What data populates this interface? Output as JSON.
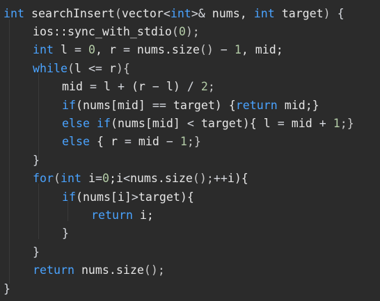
{
  "code": {
    "lines": [
      {
        "indent": 0,
        "tokens": [
          {
            "t": "int",
            "c": "kw"
          },
          {
            "t": " ",
            "c": "id"
          },
          {
            "t": "searchInsert",
            "c": "fn"
          },
          {
            "t": "(",
            "c": "punc"
          },
          {
            "t": "vector",
            "c": "id"
          },
          {
            "t": "<",
            "c": "op"
          },
          {
            "t": "int",
            "c": "kw"
          },
          {
            "t": ">&",
            "c": "op"
          },
          {
            "t": " nums, ",
            "c": "id"
          },
          {
            "t": "int",
            "c": "kw"
          },
          {
            "t": " target",
            "c": "id"
          },
          {
            "t": ")",
            "c": "punc"
          },
          {
            "t": " {",
            "c": "brace"
          }
        ]
      },
      {
        "indent": 1,
        "tokens": [
          {
            "t": "ios::sync_with_stdio",
            "c": "fn"
          },
          {
            "t": "(",
            "c": "punc"
          },
          {
            "t": "0",
            "c": "num"
          },
          {
            "t": ");",
            "c": "punc"
          }
        ]
      },
      {
        "indent": 1,
        "tokens": [
          {
            "t": "int",
            "c": "kw"
          },
          {
            "t": " l ",
            "c": "id"
          },
          {
            "t": "=",
            "c": "op"
          },
          {
            "t": " ",
            "c": "id"
          },
          {
            "t": "0",
            "c": "num"
          },
          {
            "t": ", r ",
            "c": "id"
          },
          {
            "t": "=",
            "c": "op"
          },
          {
            "t": " nums.",
            "c": "id"
          },
          {
            "t": "size",
            "c": "fn"
          },
          {
            "t": "()",
            "c": "punc"
          },
          {
            "t": " − ",
            "c": "op"
          },
          {
            "t": "1",
            "c": "num"
          },
          {
            "t": ", mid;",
            "c": "id"
          }
        ]
      },
      {
        "indent": 1,
        "tokens": [
          {
            "t": "while",
            "c": "kw"
          },
          {
            "t": "(",
            "c": "punc"
          },
          {
            "t": "l ",
            "c": "id"
          },
          {
            "t": "<=",
            "c": "op"
          },
          {
            "t": " r",
            "c": "id"
          },
          {
            "t": "){",
            "c": "punc"
          }
        ]
      },
      {
        "indent": 2,
        "tokens": [
          {
            "t": "mid ",
            "c": "id"
          },
          {
            "t": "=",
            "c": "op"
          },
          {
            "t": " l ",
            "c": "id"
          },
          {
            "t": "+",
            "c": "op"
          },
          {
            "t": " (r ",
            "c": "id"
          },
          {
            "t": "−",
            "c": "op"
          },
          {
            "t": " l) ",
            "c": "id"
          },
          {
            "t": "/",
            "c": "op"
          },
          {
            "t": " ",
            "c": "id"
          },
          {
            "t": "2",
            "c": "num"
          },
          {
            "t": ";",
            "c": "punc"
          }
        ]
      },
      {
        "indent": 2,
        "tokens": [
          {
            "t": "if",
            "c": "kw"
          },
          {
            "t": "(nums[mid] ",
            "c": "id"
          },
          {
            "t": "==",
            "c": "op"
          },
          {
            "t": " target) {",
            "c": "id"
          },
          {
            "t": "return",
            "c": "kw"
          },
          {
            "t": " mid;}",
            "c": "id"
          }
        ]
      },
      {
        "indent": 2,
        "tokens": [
          {
            "t": "else",
            "c": "kw"
          },
          {
            "t": " ",
            "c": "id"
          },
          {
            "t": "if",
            "c": "kw"
          },
          {
            "t": "(nums[mid] ",
            "c": "id"
          },
          {
            "t": "<",
            "c": "op"
          },
          {
            "t": " target){ l ",
            "c": "id"
          },
          {
            "t": "=",
            "c": "op"
          },
          {
            "t": " mid ",
            "c": "id"
          },
          {
            "t": "+",
            "c": "op"
          },
          {
            "t": " ",
            "c": "id"
          },
          {
            "t": "1",
            "c": "num"
          },
          {
            "t": ";}",
            "c": "punc"
          }
        ]
      },
      {
        "indent": 2,
        "tokens": [
          {
            "t": "else",
            "c": "kw"
          },
          {
            "t": " { r ",
            "c": "id"
          },
          {
            "t": "=",
            "c": "op"
          },
          {
            "t": " mid ",
            "c": "id"
          },
          {
            "t": "−",
            "c": "op"
          },
          {
            "t": " ",
            "c": "id"
          },
          {
            "t": "1",
            "c": "num"
          },
          {
            "t": ";}",
            "c": "punc"
          }
        ]
      },
      {
        "indent": 1,
        "tokens": [
          {
            "t": "}",
            "c": "brace"
          }
        ]
      },
      {
        "indent": 1,
        "tokens": [
          {
            "t": "for",
            "c": "kw"
          },
          {
            "t": "(",
            "c": "punc"
          },
          {
            "t": "int",
            "c": "kw"
          },
          {
            "t": " i",
            "c": "id"
          },
          {
            "t": "=",
            "c": "op"
          },
          {
            "t": "0",
            "c": "num"
          },
          {
            "t": ";i",
            "c": "id"
          },
          {
            "t": "<",
            "c": "op"
          },
          {
            "t": "nums.",
            "c": "id"
          },
          {
            "t": "size",
            "c": "fn"
          },
          {
            "t": "();",
            "c": "punc"
          },
          {
            "t": "++",
            "c": "op"
          },
          {
            "t": "i){",
            "c": "id"
          }
        ]
      },
      {
        "indent": 2,
        "tokens": [
          {
            "t": "if",
            "c": "kw"
          },
          {
            "t": "(nums[i]",
            "c": "id"
          },
          {
            "t": ">",
            "c": "op"
          },
          {
            "t": "target){",
            "c": "id"
          }
        ]
      },
      {
        "indent": 3,
        "tokens": [
          {
            "t": "return",
            "c": "kw"
          },
          {
            "t": " i;",
            "c": "id"
          }
        ]
      },
      {
        "indent": 2,
        "tokens": [
          {
            "t": "}",
            "c": "brace"
          }
        ]
      },
      {
        "indent": 1,
        "tokens": [
          {
            "t": "}",
            "c": "brace"
          }
        ]
      },
      {
        "indent": 1,
        "tokens": [
          {
            "t": "return",
            "c": "kw"
          },
          {
            "t": " nums.",
            "c": "id"
          },
          {
            "t": "size",
            "c": "fn"
          },
          {
            "t": "();",
            "c": "punc"
          }
        ]
      },
      {
        "indent": 0,
        "tokens": [
          {
            "t": "}",
            "c": "brace"
          }
        ]
      }
    ]
  },
  "colors": {
    "background": "#2b2b2b",
    "keyword": "#4aa3ff",
    "text": "#d7dae0",
    "number": "#b5cea8"
  }
}
